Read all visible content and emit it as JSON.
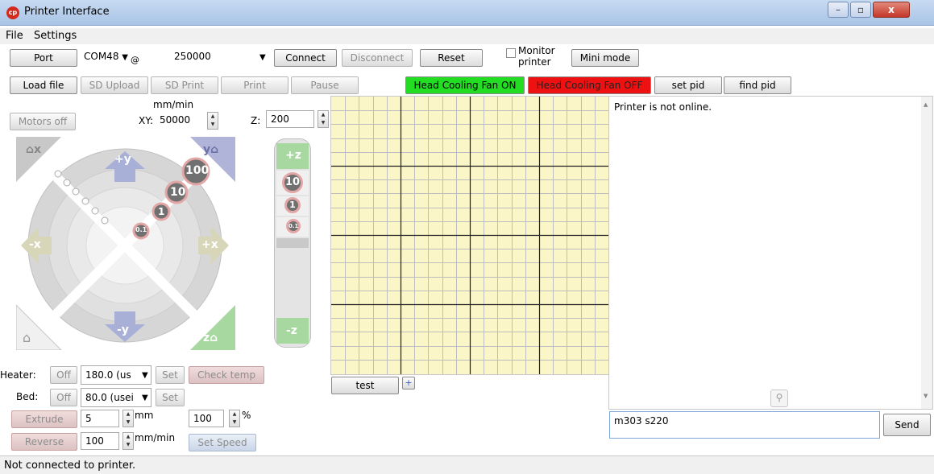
{
  "window": {
    "title": "Printer Interface",
    "controls": [
      "–",
      "▫",
      "x"
    ]
  },
  "menu": {
    "items": [
      "File",
      "Settings"
    ]
  },
  "toolbar1": {
    "port_label": "Port",
    "port_value": "COM48",
    "at": "@",
    "baud_value": "250000",
    "connect_label": "Connect",
    "disconnect_label": "Disconnect",
    "reset_label": "Reset",
    "monitor_label_1": "Monitor",
    "monitor_label_2": "printer",
    "mini_mode_label": "Mini mode"
  },
  "toolbar2": {
    "load_file": "Load file",
    "sd_upload": "SD Upload",
    "sd_print": "SD Print",
    "print": "Print",
    "pause": "Pause",
    "fan_on": "Head Cooling Fan ON",
    "fan_off": "Head Cooling Fan OFF",
    "set_pid": "set pid",
    "find_pid": "find pid",
    "fan_on_color": "#22dd22",
    "fan_off_color": "#ee1111"
  },
  "motion": {
    "motors_off": "Motors off",
    "speed_unit": "mm/min",
    "xy_label": "XY:",
    "xy_value": "50000",
    "z_label": "Z:",
    "z_value": "200"
  },
  "jog": {
    "home_x": "x",
    "home_y": "y",
    "plus_y": "+y",
    "minus_y": "-y",
    "minus_x": "-x",
    "plus_x": "+x",
    "home_z": "z",
    "step_100": "100",
    "step_10": "10",
    "step_1": "1",
    "step_01": "0.1",
    "plus_z": "+z",
    "minus_z": "-z",
    "z_step_10": "10",
    "z_step_1": "1",
    "z_step_01": "0.1"
  },
  "temps": {
    "heater_label": "Heater:",
    "heater_off": "Off",
    "heater_value": "180.0 (us",
    "heater_set": "Set",
    "check_temp": "Check temp",
    "bed_label": "Bed:",
    "bed_off": "Off",
    "bed_value": "80.0 (usei",
    "bed_set": "Set"
  },
  "extrude": {
    "extrude_label": "Extrude",
    "extrude_amount": "5",
    "extrude_unit": "mm",
    "reverse_label": "Reverse",
    "reverse_speed": "100",
    "speed_unit": "mm/min",
    "percent_value": "100",
    "percent_sign": "%",
    "set_speed": "Set Speed"
  },
  "grid": {
    "test_label": "test",
    "add_label": "+"
  },
  "console": {
    "log": "Printer is not online.",
    "command": "m303 s220",
    "send": "Send"
  },
  "status": {
    "text": "Not connected to printer."
  }
}
